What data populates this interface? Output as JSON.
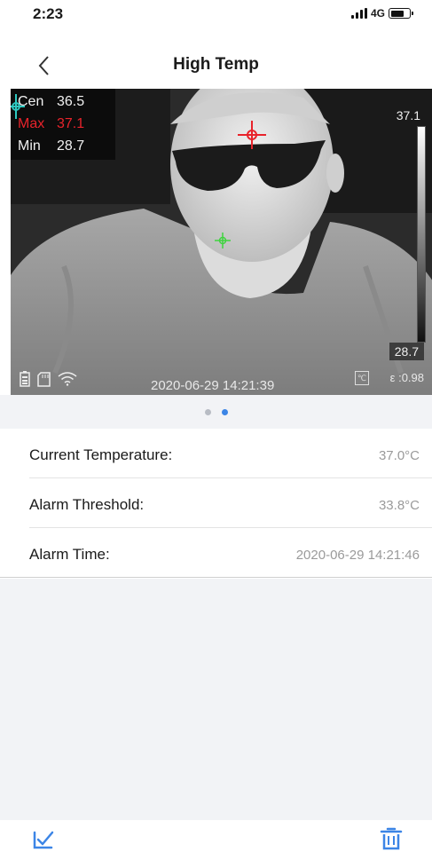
{
  "status_bar": {
    "time": "2:23",
    "network": "4G"
  },
  "nav": {
    "title": "High Temp"
  },
  "thermal": {
    "stats": [
      {
        "label": "Cen",
        "value": "36.5"
      },
      {
        "label": "Max",
        "value": "37.1"
      },
      {
        "label": "Min",
        "value": "28.7"
      }
    ],
    "scale_max": "37.1",
    "scale_min": "28.7",
    "timestamp": "2020-06-29 14:21:39",
    "unit": "℃",
    "emissivity": "ε :0.98"
  },
  "pager": {
    "count": 2,
    "active": 1
  },
  "info": [
    {
      "label": "Current Temperature:",
      "value": "37.0°C"
    },
    {
      "label": "Alarm Threshold:",
      "value": "33.8°C"
    },
    {
      "label": "Alarm Time:",
      "value": "2020-06-29 14:21:46"
    }
  ],
  "colors": {
    "accent": "#3c85e6",
    "max_marker": "#e8232b",
    "center_marker": "#2ec8c0",
    "min_marker": "#3fd43f"
  },
  "icons": {
    "back": "chevron-left-icon",
    "edit": "edit-check-icon",
    "delete": "trash-icon"
  }
}
